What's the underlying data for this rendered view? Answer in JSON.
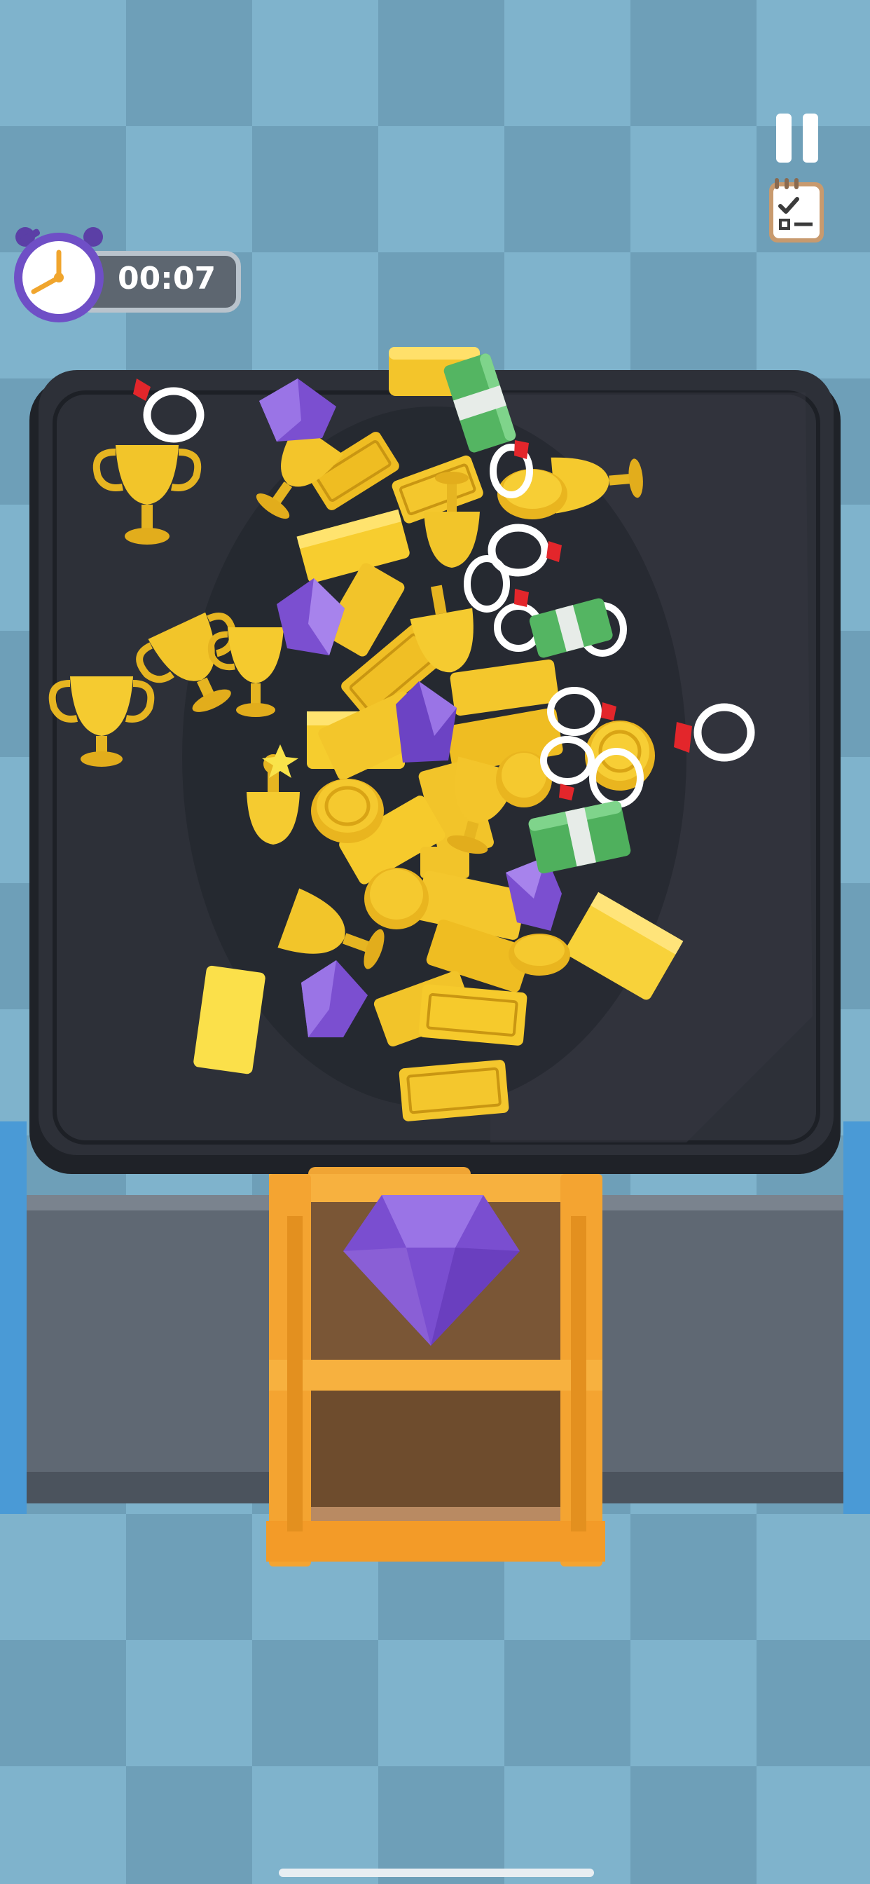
{
  "hud": {
    "timer": "00:07",
    "timer_icon": "alarm-clock-icon",
    "pause_icon": "pause-icon",
    "checklist_icon": "checklist-icon"
  },
  "colors": {
    "floor_light": "#7fb3cc",
    "floor_dark": "#6e9fb8",
    "table": "#2c2f36",
    "gold": "#f2c62a",
    "gem": "#8a5fd6",
    "cash": "#5cc06a",
    "crate": "#f0a83a",
    "conveyor": "#6b7480"
  },
  "items": {
    "gold_bar": "gold-bar",
    "trophy": "trophy",
    "coin": "coin",
    "ring": "ring",
    "gem": "gem",
    "cash": "cash-stack"
  }
}
